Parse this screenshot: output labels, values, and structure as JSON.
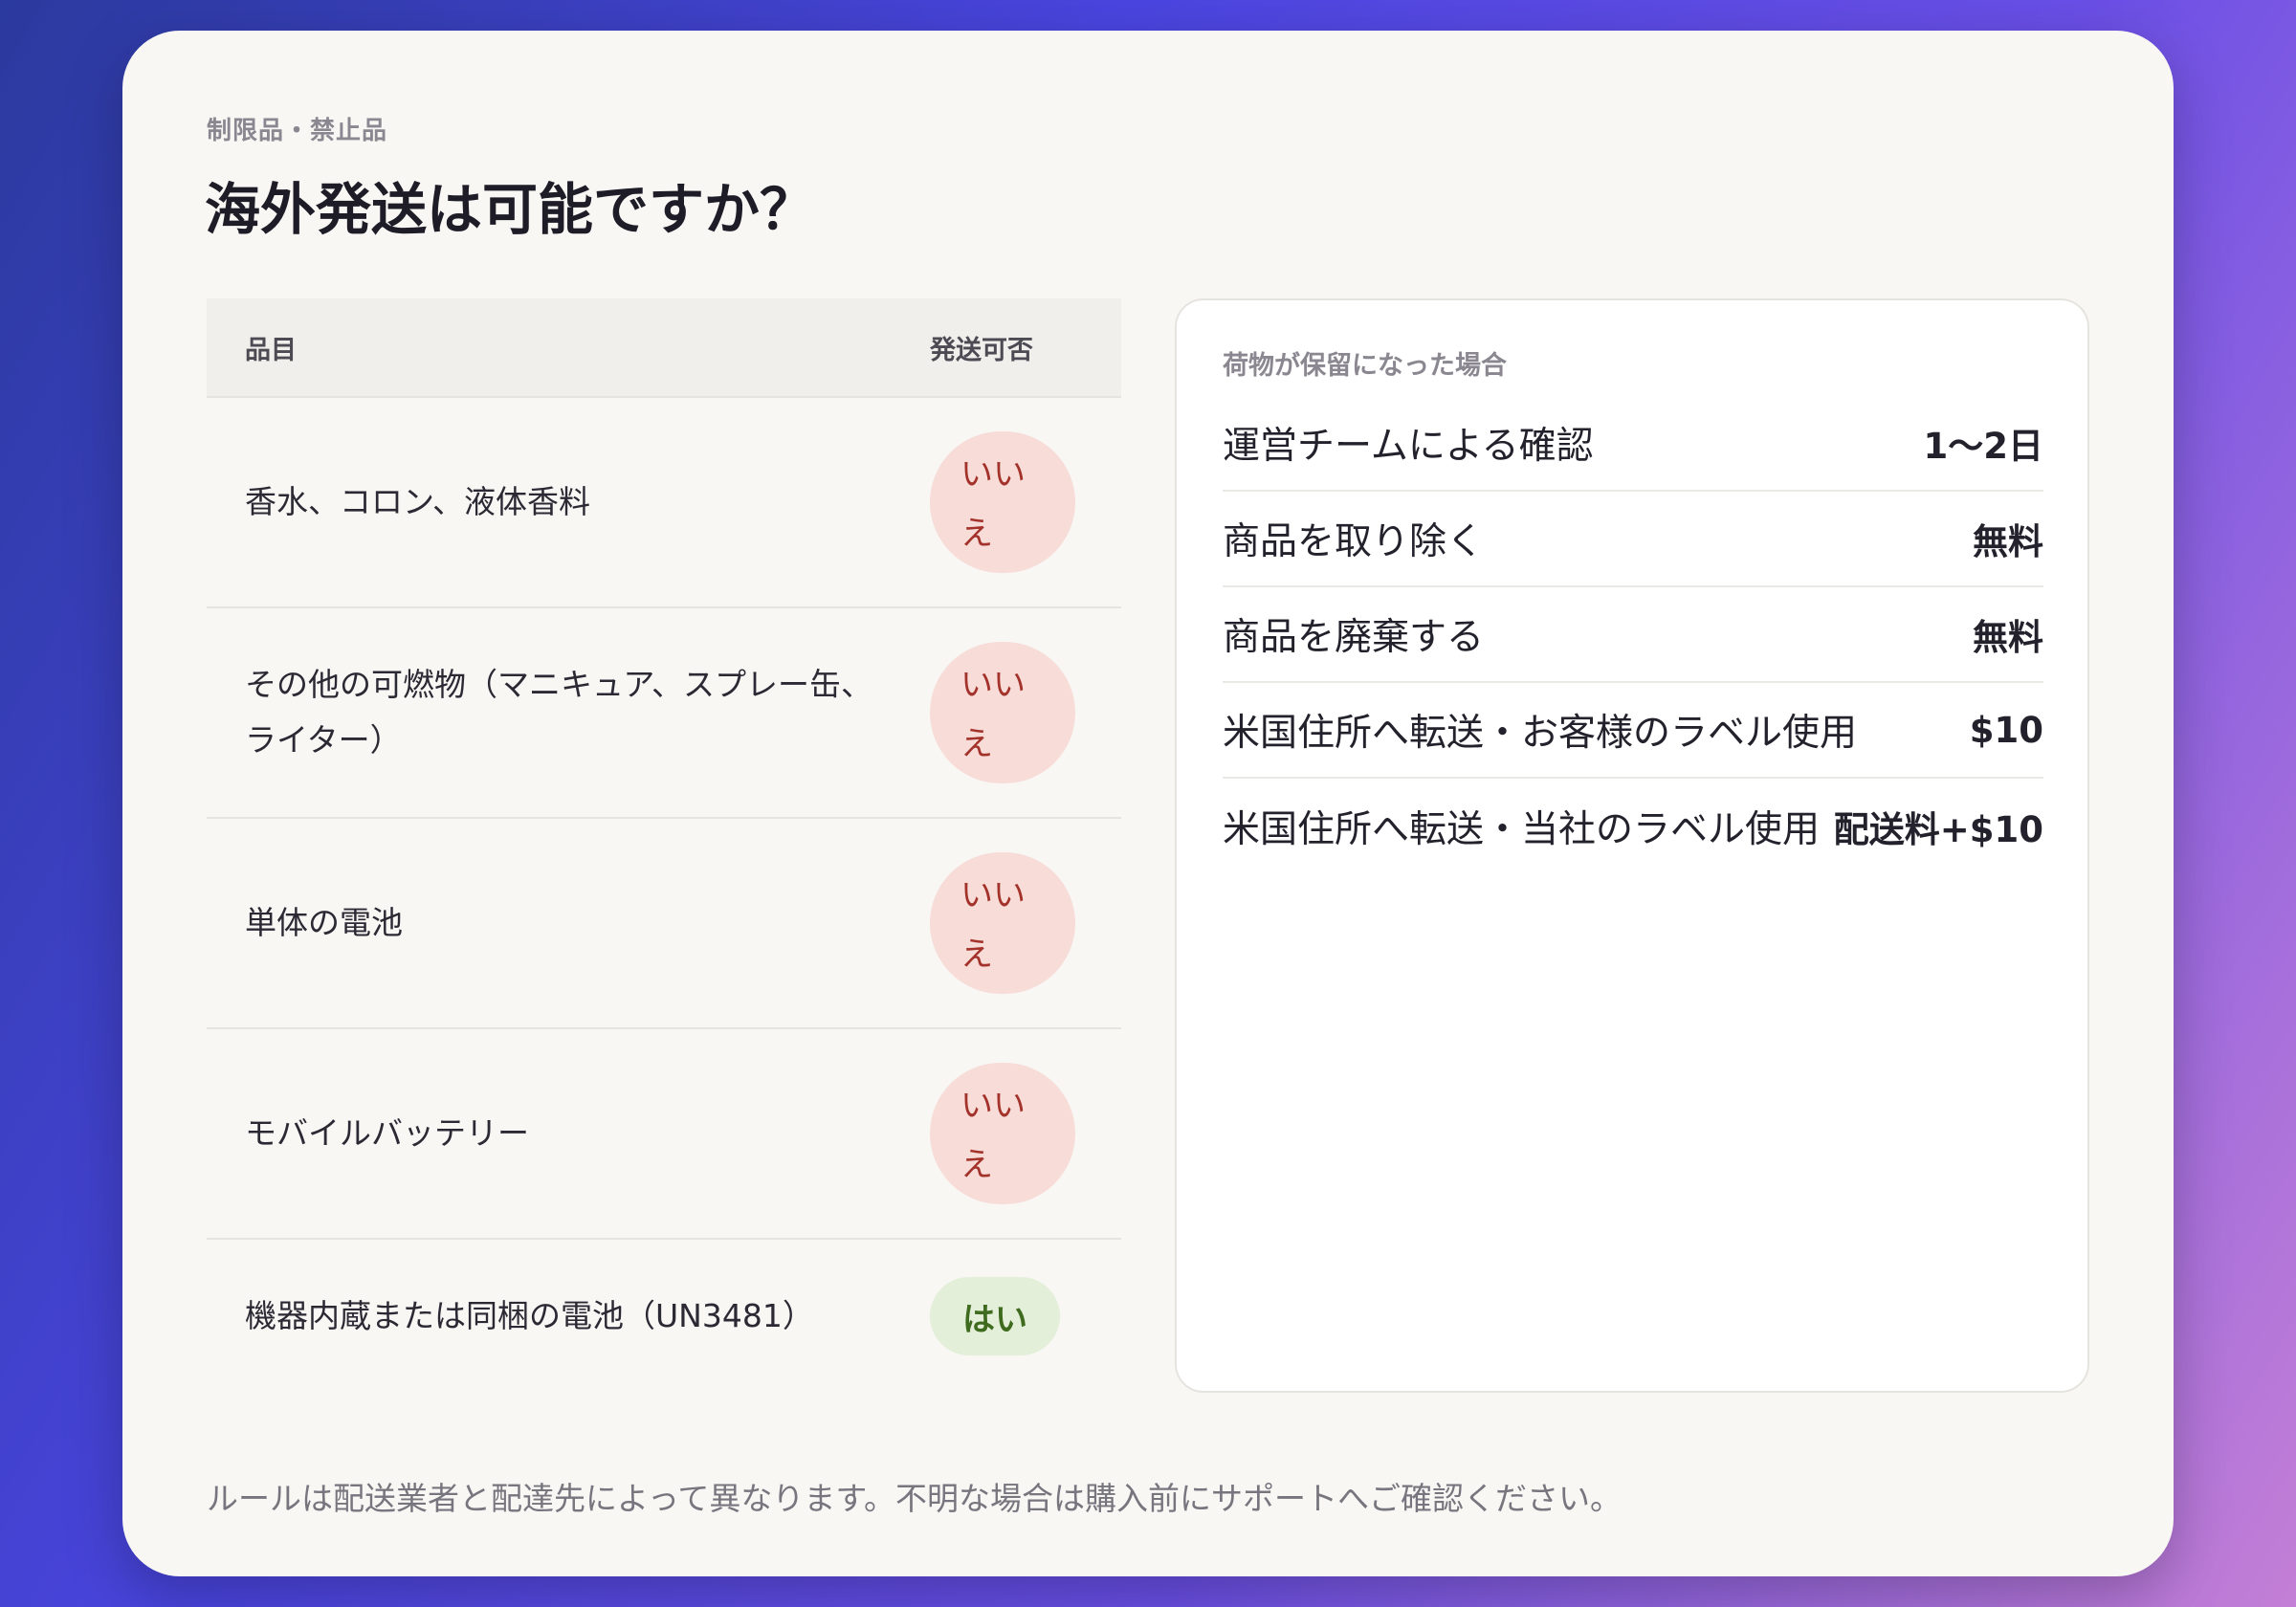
{
  "header": {
    "eyebrow": "制限品・禁止品",
    "title": "海外発送は可能ですか？"
  },
  "table": {
    "col_item": "品目",
    "col_status": "発送可否",
    "rows": [
      {
        "item": "香水、コロン、液体香料",
        "status": "いいえ"
      },
      {
        "item": "その他の可燃物（マニキュア、スプレー缶、ライター）",
        "status": "いいえ"
      },
      {
        "item": "単体の電池",
        "status": "いいえ"
      },
      {
        "item": "モバイルバッテリー",
        "status": "いいえ"
      },
      {
        "item": "機器内蔵または同梱の電池（UN3481）",
        "status": "はい"
      }
    ]
  },
  "panel": {
    "title": "荷物が保留になった場合",
    "rows": [
      {
        "label": "運営チームによる確認",
        "value": "1〜2日"
      },
      {
        "label": "商品を取り除く",
        "value": "無料"
      },
      {
        "label": "商品を廃棄する",
        "value": "無料"
      },
      {
        "label": "米国住所へ転送・お客様のラベル使用",
        "value": "$10"
      },
      {
        "label": "米国住所へ転送・当社のラベル使用",
        "value": "配送料+$10"
      }
    ]
  },
  "footnote": "ルールは配送業者と配達先によって異なります。不明な場合は購入前にサポートへご確認ください。",
  "colors": {
    "badge_no_bg": "#f7dcd8",
    "badge_no_text": "#a3322a",
    "badge_yes_bg": "#e3efd9",
    "badge_yes_text": "#3f6b1f"
  }
}
